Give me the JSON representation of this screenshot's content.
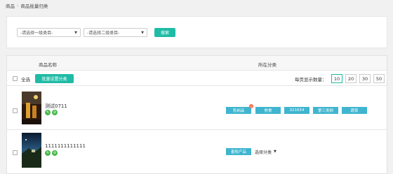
{
  "breadcrumb": {
    "home": "商品",
    "separator": "›",
    "current": "商品批量归类"
  },
  "filters": {
    "level1_value": "-请选择一级类目-",
    "level2_value": "-请选择二级类目-",
    "search_label": "搜索"
  },
  "table": {
    "col_name": "商品名称",
    "col_category": "所在分类",
    "select_all_label": "全选",
    "batch_button_label": "批量设置分类",
    "per_page_label": "每页显示数量：",
    "page_sizes": [
      "10",
      "20",
      "30",
      "50"
    ],
    "page_size_selected": "10"
  },
  "rows": [
    {
      "title": "测试0711",
      "tags": [
        "乳制品",
        "熟食",
        "321654",
        "第三类网",
        "蔬菜"
      ]
    },
    {
      "title": "1111111111111",
      "tags": [
        "畜牧产品"
      ],
      "select_value": "选择分类"
    }
  ],
  "colors": {
    "accent": "#1fbba6",
    "tag": "#3fb5cf",
    "icon_green": "#49b74a"
  }
}
